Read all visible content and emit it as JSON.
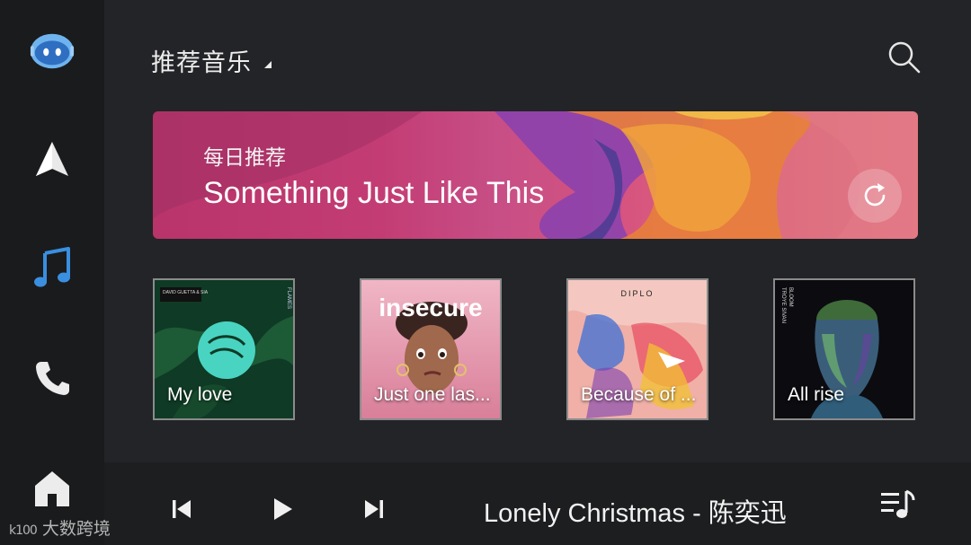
{
  "header": {
    "title": "推荐音乐"
  },
  "banner": {
    "subtitle": "每日推荐",
    "title": "Something Just Like This"
  },
  "albums": [
    {
      "label": "My love",
      "cover_text": [
        "DAVID GUETTA & SIA",
        "FLAMES"
      ]
    },
    {
      "label": "Just one las...",
      "cover_text": [
        "insecure"
      ]
    },
    {
      "label": "Because of ...",
      "cover_text": [
        "DIPLO"
      ]
    },
    {
      "label": "All rise",
      "cover_text": [
        "TROYE SIVAN",
        "BLOOM"
      ]
    }
  ],
  "player": {
    "now_playing": "Lonely Christmas - 陈奕迅"
  },
  "watermark": {
    "logo": "k100",
    "text": "大数跨境"
  },
  "colors": {
    "background": "#232427",
    "sidebar": "#1a1b1d",
    "accent": "#3a8fe0"
  }
}
